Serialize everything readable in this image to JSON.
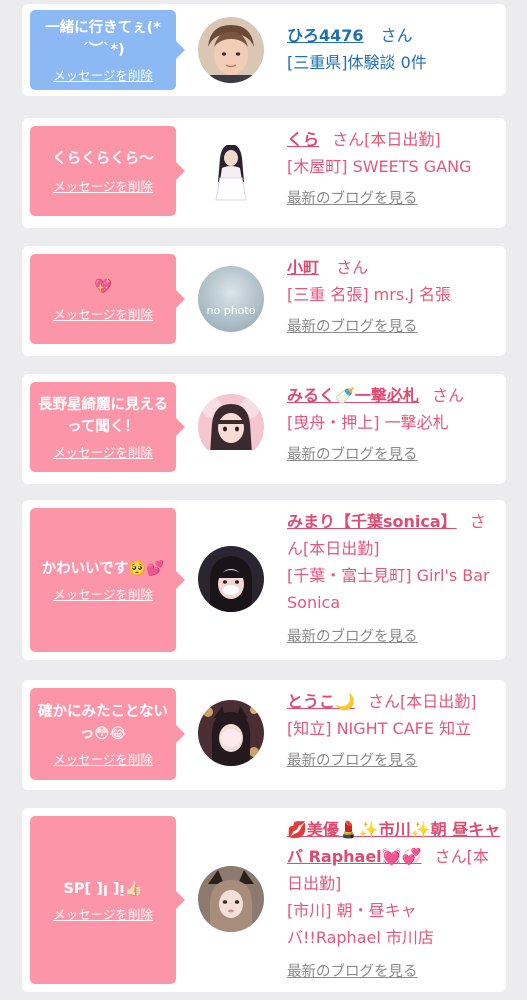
{
  "cards": [
    {
      "bubble_color": "#8cb8f4",
      "message": "一緒に行きてぇ(*´︶`*)",
      "delete_label": "メッセージを削除",
      "avatar": "male-user-photo",
      "name": "ひろ4476",
      "honorific": "さん",
      "detail": "[三重県]体験談 0件",
      "blog_link": ""
    },
    {
      "bubble_color": "#fc95a8",
      "message": "くらくらくら〜",
      "delete_label": "メッセージを削除",
      "avatar": "cast-photo",
      "name": "くら",
      "honorific": "さん[本日出勤]",
      "detail": "[木屋町] SWEETS GANG",
      "blog_link": "最新のブログを見る"
    },
    {
      "bubble_color": "#fc95a8",
      "message": "💖",
      "delete_label": "メッセージを削除",
      "avatar": "no-photo-placeholder",
      "avatar_text": "no photo",
      "name": "小町",
      "honorific": "さん",
      "detail": "[三重 名張] mrs.J 名張",
      "blog_link": "最新のブログを見る"
    },
    {
      "bubble_color": "#fc95a8",
      "message": "長野星綺麗に見えるって聞く！",
      "delete_label": "メッセージを削除",
      "avatar": "cast-photo",
      "name": "みるく🍼一撃必札",
      "honorific": "さん",
      "detail": "[曳舟・押上] 一撃必札",
      "blog_link": "最新のブログを見る"
    },
    {
      "bubble_color": "#fc95a8",
      "message": "かわいいです🥺💕",
      "delete_label": "メッセージを削除",
      "avatar": "cast-photo",
      "name": "みまり【千葉sonica】",
      "honorific": "さん[本日出勤]",
      "detail": "[千葉・富士見町] Girl's Bar Sonica",
      "blog_link": "最新のブログを見る"
    },
    {
      "bubble_color": "#fc95a8",
      "message": "確かにみたことないっ😳😂",
      "delete_label": "メッセージを削除",
      "avatar": "cast-photo",
      "name": "とうこ🌙",
      "honorific": "さん[本日出勤]",
      "detail": "[知立] NIGHT CAFE 知立",
      "blog_link": "最新のブログを見る"
    },
    {
      "bubble_color": "#fc95a8",
      "message": "SP[ ]ꞁ ]ᴉ👍🏻",
      "delete_label": "メッセージを削除",
      "avatar": "cast-photo",
      "name": "💋美優💄✨市川✨朝 昼キャバ Raphael💓💞",
      "honorific": "さん[本日出勤]",
      "detail": "[市川] 朝・昼キャバ!!Raphael 市川店",
      "blog_link": "最新のブログを見る"
    }
  ]
}
